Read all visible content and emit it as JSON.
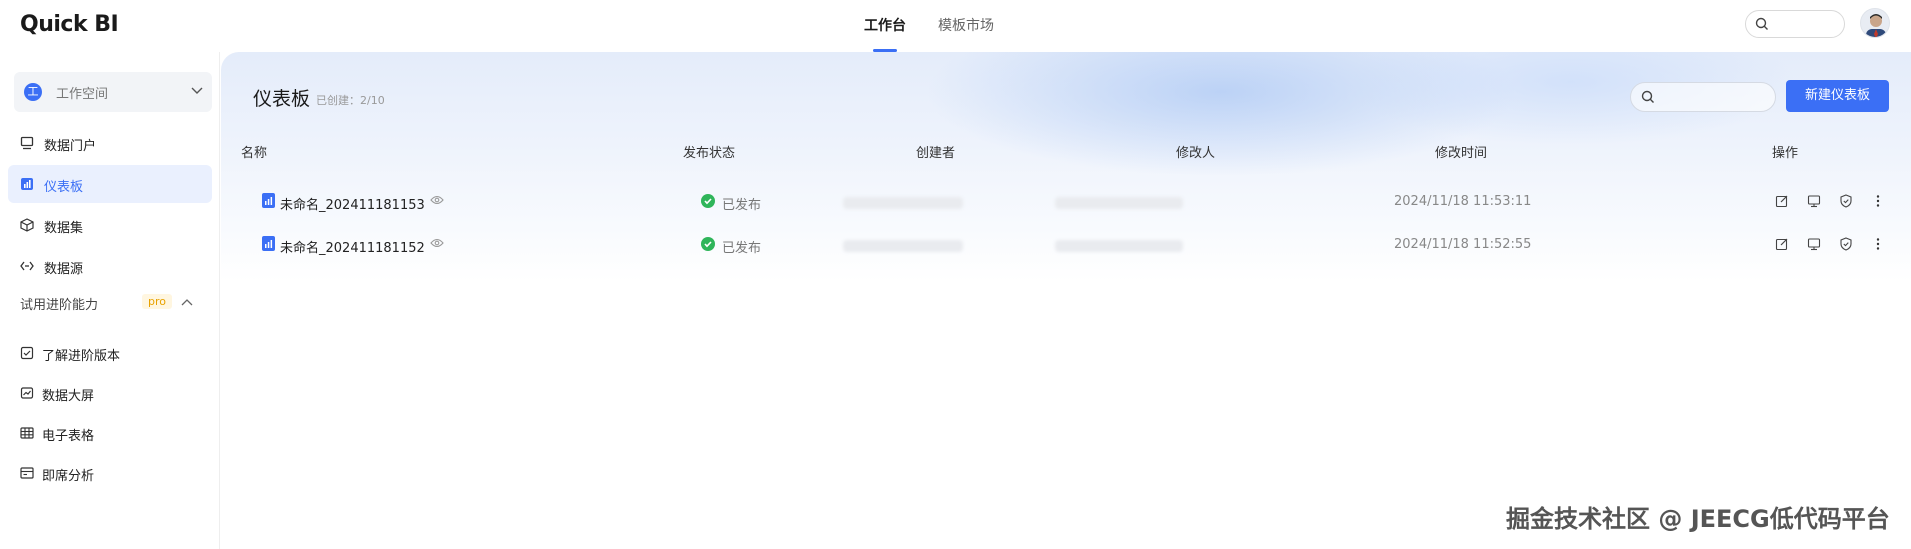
{
  "app": {
    "logo": "Quick BI"
  },
  "topnav": {
    "tabs": [
      {
        "label": "工作台",
        "active": true
      },
      {
        "label": "模板市场",
        "active": false
      }
    ]
  },
  "sidebar": {
    "workspace": {
      "badge": "工",
      "label": "工作空间"
    },
    "items": [
      {
        "label": "数据门户",
        "icon": "monitor-icon",
        "active": false
      },
      {
        "label": "仪表板",
        "icon": "dashboard-icon",
        "active": true
      },
      {
        "label": "数据集",
        "icon": "cube-icon",
        "active": false
      },
      {
        "label": "数据源",
        "icon": "link-icon",
        "active": false
      }
    ],
    "group": {
      "label": "试用进阶能力",
      "badge": "pro"
    },
    "group_items": [
      {
        "label": "了解进阶版本",
        "icon": "check-box-icon"
      },
      {
        "label": "数据大屏",
        "icon": "chart-screen-icon"
      },
      {
        "label": "电子表格",
        "icon": "table-icon"
      },
      {
        "label": "即席分析",
        "icon": "analysis-icon"
      }
    ]
  },
  "main": {
    "title": "仪表板",
    "count": "已创建：2/10",
    "new_button": "新建仪表板",
    "columns": [
      "名称",
      "发布状态",
      "创建者",
      "修改人",
      "修改时间",
      "操作"
    ],
    "rows": [
      {
        "name": "未命名_202411181153",
        "status": "已发布",
        "modified_time": "2024/11/18 11:53:11"
      },
      {
        "name": "未命名_202411181152",
        "status": "已发布",
        "modified_time": "2024/11/18 11:52:55"
      }
    ]
  },
  "watermark": "掘金技术社区 @ JEECG低代码平台",
  "colors": {
    "accent": "#3b6ff5",
    "published": "#2fb55a"
  }
}
